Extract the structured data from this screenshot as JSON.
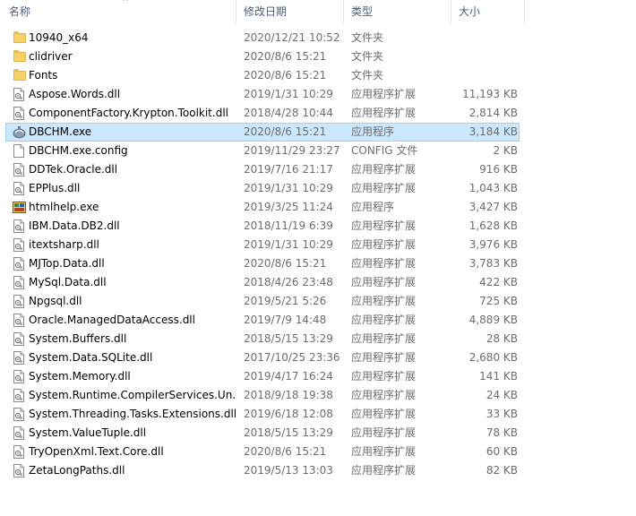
{
  "header": {
    "name": "名称",
    "date": "修改日期",
    "type": "类型",
    "size": "大小",
    "sort_indicator": "^"
  },
  "files": [
    {
      "name": "10940_x64",
      "date": "2020/12/21 10:52",
      "type": "文件夹",
      "size": "",
      "icon": "folder-icon"
    },
    {
      "name": "clidriver",
      "date": "2020/8/6 15:21",
      "type": "文件夹",
      "size": "",
      "icon": "folder-icon"
    },
    {
      "name": "Fonts",
      "date": "2020/8/6 15:21",
      "type": "文件夹",
      "size": "",
      "icon": "folder-icon"
    },
    {
      "name": "Aspose.Words.dll",
      "date": "2019/1/31 10:29",
      "type": "应用程序扩展",
      "size": "11,193 KB",
      "icon": "dll-icon"
    },
    {
      "name": "ComponentFactory.Krypton.Toolkit.dll",
      "date": "2018/4/28 10:44",
      "type": "应用程序扩展",
      "size": "2,814 KB",
      "icon": "dll-icon"
    },
    {
      "name": "DBCHM.exe",
      "date": "2020/8/6 15:21",
      "type": "应用程序",
      "size": "3,184 KB",
      "icon": "dbchm-app-icon",
      "selected": true
    },
    {
      "name": "DBCHM.exe.config",
      "date": "2019/11/29 23:27",
      "type": "CONFIG 文件",
      "size": "2 KB",
      "icon": "file-icon"
    },
    {
      "name": "DDTek.Oracle.dll",
      "date": "2019/7/16 21:17",
      "type": "应用程序扩展",
      "size": "916 KB",
      "icon": "dll-icon"
    },
    {
      "name": "EPPlus.dll",
      "date": "2019/1/31 10:29",
      "type": "应用程序扩展",
      "size": "1,043 KB",
      "icon": "dll-icon"
    },
    {
      "name": "htmlhelp.exe",
      "date": "2019/3/25 11:24",
      "type": "应用程序",
      "size": "3,427 KB",
      "icon": "htmlhelp-app-icon"
    },
    {
      "name": "IBM.Data.DB2.dll",
      "date": "2018/11/19 6:39",
      "type": "应用程序扩展",
      "size": "1,628 KB",
      "icon": "dll-icon"
    },
    {
      "name": "itextsharp.dll",
      "date": "2019/1/31 10:29",
      "type": "应用程序扩展",
      "size": "3,976 KB",
      "icon": "dll-icon"
    },
    {
      "name": "MJTop.Data.dll",
      "date": "2020/8/6 15:21",
      "type": "应用程序扩展",
      "size": "3,783 KB",
      "icon": "dll-icon"
    },
    {
      "name": "MySql.Data.dll",
      "date": "2018/4/26 23:48",
      "type": "应用程序扩展",
      "size": "422 KB",
      "icon": "dll-icon"
    },
    {
      "name": "Npgsql.dll",
      "date": "2019/5/21 5:26",
      "type": "应用程序扩展",
      "size": "725 KB",
      "icon": "dll-icon"
    },
    {
      "name": "Oracle.ManagedDataAccess.dll",
      "date": "2019/7/9 14:48",
      "type": "应用程序扩展",
      "size": "4,889 KB",
      "icon": "dll-icon"
    },
    {
      "name": "System.Buffers.dll",
      "date": "2018/5/15 13:29",
      "type": "应用程序扩展",
      "size": "28 KB",
      "icon": "dll-icon"
    },
    {
      "name": "System.Data.SQLite.dll",
      "date": "2017/10/25 23:36",
      "type": "应用程序扩展",
      "size": "2,680 KB",
      "icon": "dll-icon"
    },
    {
      "name": "System.Memory.dll",
      "date": "2019/4/17 16:24",
      "type": "应用程序扩展",
      "size": "141 KB",
      "icon": "dll-icon"
    },
    {
      "name": "System.Runtime.CompilerServices.Un...",
      "date": "2018/9/18 19:38",
      "type": "应用程序扩展",
      "size": "24 KB",
      "icon": "dll-icon"
    },
    {
      "name": "System.Threading.Tasks.Extensions.dll",
      "date": "2019/6/18 12:08",
      "type": "应用程序扩展",
      "size": "33 KB",
      "icon": "dll-icon"
    },
    {
      "name": "System.ValueTuple.dll",
      "date": "2018/5/15 13:29",
      "type": "应用程序扩展",
      "size": "78 KB",
      "icon": "dll-icon"
    },
    {
      "name": "TryOpenXml.Text.Core.dll",
      "date": "2020/8/6 15:21",
      "type": "应用程序扩展",
      "size": "60 KB",
      "icon": "dll-icon"
    },
    {
      "name": "ZetaLongPaths.dll",
      "date": "2019/5/13 13:03",
      "type": "应用程序扩展",
      "size": "82 KB",
      "icon": "dll-icon"
    }
  ]
}
